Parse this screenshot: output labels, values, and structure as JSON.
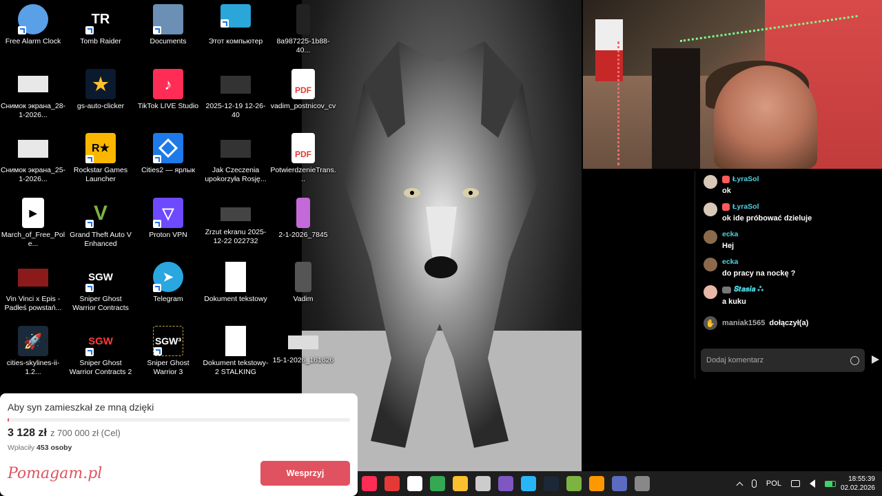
{
  "desktop": {
    "icons": [
      {
        "label": "Free Alarm Clock",
        "icon": "alarm-clock-icon",
        "color": "#5aa0e6"
      },
      {
        "label": "Tomb Raider",
        "icon": "tomb-raider-icon",
        "color": "#000000"
      },
      {
        "label": "Documents",
        "icon": "folder-icon",
        "color": "#6b8fb5"
      },
      {
        "label": "Этот компьютер",
        "icon": "monitor-icon",
        "color": "#2aa6d8"
      },
      {
        "label": "8a987225-1b88-40...",
        "icon": "image-file-icon",
        "color": "#222222"
      },
      {
        "label": "Снимок экрана_28-1-2026...",
        "icon": "screenshot-icon",
        "color": "#e8e8e8"
      },
      {
        "label": "gs-auto-clicker",
        "icon": "star-icon",
        "color": "#0b1a2e"
      },
      {
        "label": "TikTok LIVE Studio",
        "icon": "tiktok-icon",
        "color": "#ff2d55"
      },
      {
        "label": "2025-12-19 12-26-40",
        "icon": "video-file-icon",
        "color": "#333333"
      },
      {
        "label": "vadim_postnicov_cv",
        "icon": "pdf-icon",
        "color": "#e53935"
      },
      {
        "label": "Снимок экрана_25-1-2026...",
        "icon": "screenshot-icon",
        "color": "#e8e8e8"
      },
      {
        "label": "Rockstar Games Launcher",
        "icon": "rockstar-icon",
        "color": "#fbb700"
      },
      {
        "label": "Cities2 — ярлык",
        "icon": "cities2-icon",
        "color": "#1e7ae8"
      },
      {
        "label": "Jak Czeczenia upokorzyła Rosję...",
        "icon": "video-file-icon",
        "color": "#333333"
      },
      {
        "label": "PotwierdzenieTrans...",
        "icon": "pdf-icon",
        "color": "#e53935"
      },
      {
        "label": "March_of_Free_Pole...",
        "icon": "video-play-icon",
        "color": "#ffffff"
      },
      {
        "label": "Grand Theft Auto V Enhanced",
        "icon": "gta-icon",
        "color": "#000000"
      },
      {
        "label": "Proton VPN",
        "icon": "proton-vpn-icon",
        "color": "#6d4aff"
      },
      {
        "label": "Zrzut ekranu 2025-12-22 022732",
        "icon": "screenshot-icon",
        "color": "#444444"
      },
      {
        "label": "2-1-2026_7845",
        "icon": "image-file-icon",
        "color": "#c46ad8"
      },
      {
        "label": "Vin Vinci x Epis - Padłeś powstań...",
        "icon": "video-file-icon",
        "color": "#8b1a1a"
      },
      {
        "label": "Sniper Ghost Warrior Contracts",
        "icon": "sgw-icon",
        "color": "#000000"
      },
      {
        "label": "Telegram",
        "icon": "telegram-icon",
        "color": "#2aa6e0"
      },
      {
        "label": "Dokument tekstowy",
        "icon": "text-file-icon",
        "color": "#ffffff"
      },
      {
        "label": "Vadim",
        "icon": "image-file-icon",
        "color": "#555555"
      },
      {
        "label": "cities-skylines-ii-1.2...",
        "icon": "rocket-icon",
        "color": "#1a2a3a"
      },
      {
        "label": "Sniper Ghost Warrior Contracts 2",
        "icon": "sgw2-icon",
        "color": "#000000"
      },
      {
        "label": "Sniper Ghost Warrior 3",
        "icon": "sgw3-icon",
        "color": "#000000"
      },
      {
        "label": "Dokument tekstowy-2 STALKING",
        "icon": "text-file-icon",
        "color": "#ffffff"
      },
      {
        "label": "15-1-2026_161626",
        "icon": "screenshot-icon",
        "color": "#dddddd"
      }
    ],
    "tile_text": {
      "tomb_raider": "TR",
      "pdf": "PDF",
      "sgw": "SGW",
      "sgw3": "SGW³",
      "rockstar": "R★"
    }
  },
  "chat": {
    "messages": [
      {
        "user": "ŁyraSol",
        "text": "ok",
        "badge": "heart",
        "avatar_color": "#d8c8b8"
      },
      {
        "user": "ŁyraSol",
        "text": "ok ide próbować dzieluje",
        "badge": "heart",
        "avatar_color": "#d8c8b8"
      },
      {
        "user": "ecka",
        "text": "Hej",
        "badge": "",
        "avatar_color": "#8a6a4a"
      },
      {
        "user": "ecka",
        "text": "do pracy na nockę ?",
        "badge": "",
        "avatar_color": "#8a6a4a"
      },
      {
        "user": "𝑺𝒕𝒂𝒔𝒊𝒂 ⁂",
        "text": "a kuku",
        "badge": "mod",
        "avatar_color": "#e8b8a8"
      }
    ],
    "join": {
      "user": "maniak1565",
      "text": "dołączył(a)"
    },
    "input_placeholder": "Dodaj komentarz"
  },
  "donation": {
    "title": "Aby syn zamieszkał ze mną dzięki",
    "amount": "3 128 zł",
    "goal": "z 700 000 zł (Cel)",
    "count_label": "Wpłaciły",
    "count_value": "453 osoby",
    "brand": "Pomagam.pl",
    "button": "Wesprzyj",
    "progress": 0.0045
  },
  "taskbar": {
    "apps": [
      {
        "icon": "tiktok-taskbar-icon",
        "color": "#ff2d55"
      },
      {
        "icon": "rockstar-taskbar-icon",
        "color": "#e53935"
      },
      {
        "icon": "app-taskbar-icon",
        "color": "#ffffff"
      },
      {
        "icon": "chrome-icon",
        "color": "#34a853"
      },
      {
        "icon": "star-taskbar-icon",
        "color": "#fbc02d"
      },
      {
        "icon": "box-taskbar-icon",
        "color": "#cccccc"
      },
      {
        "icon": "app2-taskbar-icon",
        "color": "#7e57c2"
      },
      {
        "icon": "photos-icon",
        "color": "#29b6f6"
      },
      {
        "icon": "steam-icon",
        "color": "#1b2838"
      },
      {
        "icon": "game-taskbar-icon",
        "color": "#7cb342"
      },
      {
        "icon": "media-player-icon",
        "color": "#ff9800"
      },
      {
        "icon": "teams-icon",
        "color": "#5c6bc0"
      },
      {
        "icon": "settings-notify-icon",
        "color": "#888888"
      }
    ],
    "language": "POL",
    "time": "18:55:39",
    "date": "02.02.2026"
  }
}
